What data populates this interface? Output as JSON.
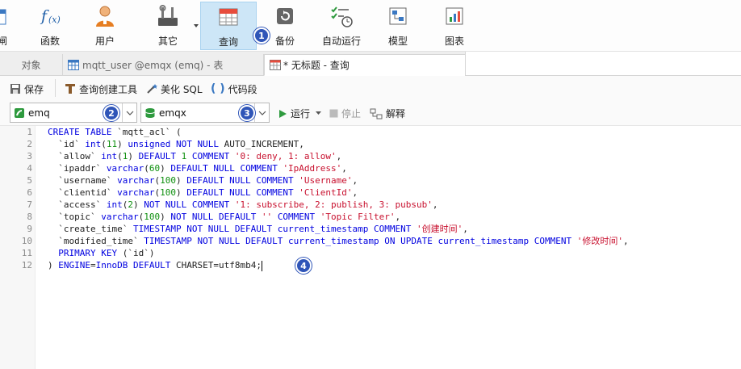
{
  "ribbon": {
    "items": [
      {
        "label": "函数"
      },
      {
        "label": "用户"
      },
      {
        "label": "其它"
      },
      {
        "label": "查询"
      },
      {
        "label": "备份"
      },
      {
        "label": "自动运行"
      },
      {
        "label": "模型"
      },
      {
        "label": "图表"
      }
    ],
    "partial_label": "闸"
  },
  "tabs": [
    {
      "label": "对象"
    },
    {
      "label": "mqtt_user @emqx (emq) - 表"
    },
    {
      "label": "* 无标题 - 查询"
    }
  ],
  "toolbar": {
    "save_label": "保存",
    "query_builder_label": "查询创建工具",
    "beautify_label": "美化 SQL",
    "snippet_label": "代码段"
  },
  "selectors": {
    "connection": "emq",
    "database": "emqx"
  },
  "actions": {
    "run_label": "运行",
    "stop_label": "停止",
    "explain_label": "解释"
  },
  "badges": [
    "1",
    "2",
    "3",
    "4"
  ],
  "editor": {
    "line_numbers": [
      "1",
      "2",
      "3",
      "4",
      "5",
      "6",
      "7",
      "8",
      "9",
      "10",
      "11",
      "12"
    ]
  },
  "colors": {
    "accent": "#2f55b8",
    "keyword": "#0000e0",
    "number": "#0d8f0d",
    "string": "#c8102e",
    "active_ribbon": "#cde6f7"
  }
}
